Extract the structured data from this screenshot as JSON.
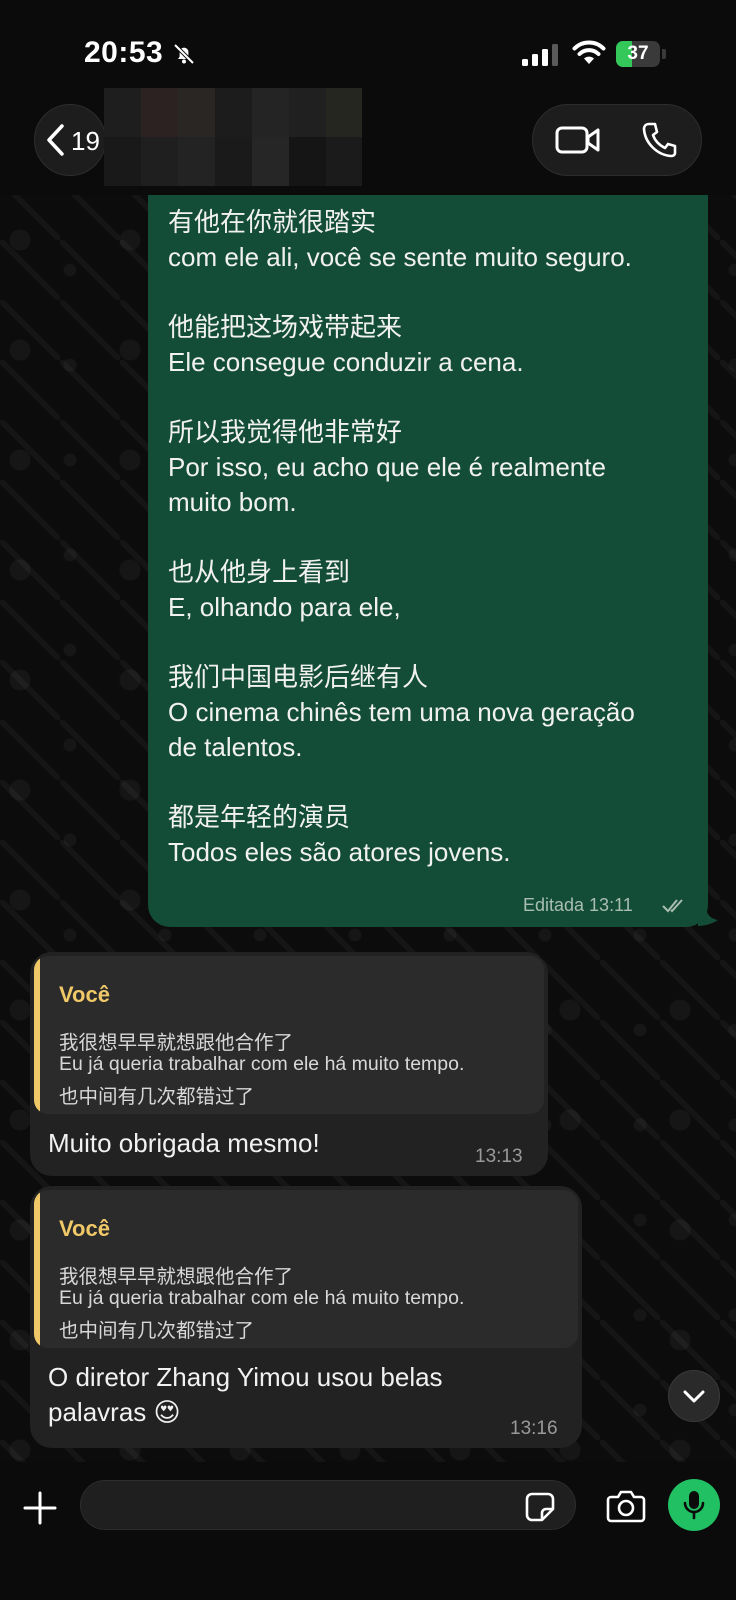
{
  "status_bar": {
    "time": "20:53",
    "battery": "37",
    "battery_level": 0.37,
    "icons": [
      "bell-off-icon",
      "signal-icon",
      "wifi-icon",
      "battery-icon"
    ]
  },
  "header": {
    "back_count": "19",
    "icons": [
      "chevron-left-icon",
      "video-call-icon",
      "phone-call-icon"
    ]
  },
  "messages": [
    {
      "direction": "outgoing",
      "lines": [
        "有他在你就很踏实",
        "com ele ali, você se sente muito seguro.",
        "",
        "他能把这场戏带起来",
        "Ele consegue conduzir a cena.",
        "",
        "所以我觉得他非常好",
        "Por isso, eu acho que ele é realmente",
        "muito bom.",
        "",
        "也从他身上看到",
        "E, olhando para ele,",
        "",
        "我们中国电影后继有人",
        "O cinema chinês tem uma nova geração",
        "de talentos.",
        "",
        "都是年轻的演员",
        "Todos eles são atores jovens."
      ],
      "meta": "Editada 13:11",
      "status": "read"
    },
    {
      "direction": "incoming",
      "quote": {
        "author": "Você",
        "lines": [
          "我很想早早就想跟他合作了",
          "Eu já queria trabalhar com ele há muito tempo.",
          "也中间有几次都错过了"
        ]
      },
      "lines": [
        "Muito obrigada mesmo!"
      ],
      "time": "13:13"
    },
    {
      "direction": "incoming",
      "quote": {
        "author": "Você",
        "lines": [
          "我很想早早就想跟他合作了",
          "Eu já queria trabalhar com ele há muito tempo.",
          "也中间有几次都错过了"
        ]
      },
      "lines": [
        "O diretor Zhang Yimou usou belas",
        "palavras 😍"
      ],
      "time": "13:16"
    }
  ],
  "composer": {
    "placeholder": "",
    "icons": [
      "plus-icon",
      "sticker-icon",
      "camera-icon",
      "microphone-icon"
    ]
  },
  "colors": {
    "outgoing_bubble": "#144d37",
    "incoming_bubble": "#222222",
    "quote_accent": "#f0c868",
    "mic_button": "#21c063",
    "battery": "#34c759"
  }
}
